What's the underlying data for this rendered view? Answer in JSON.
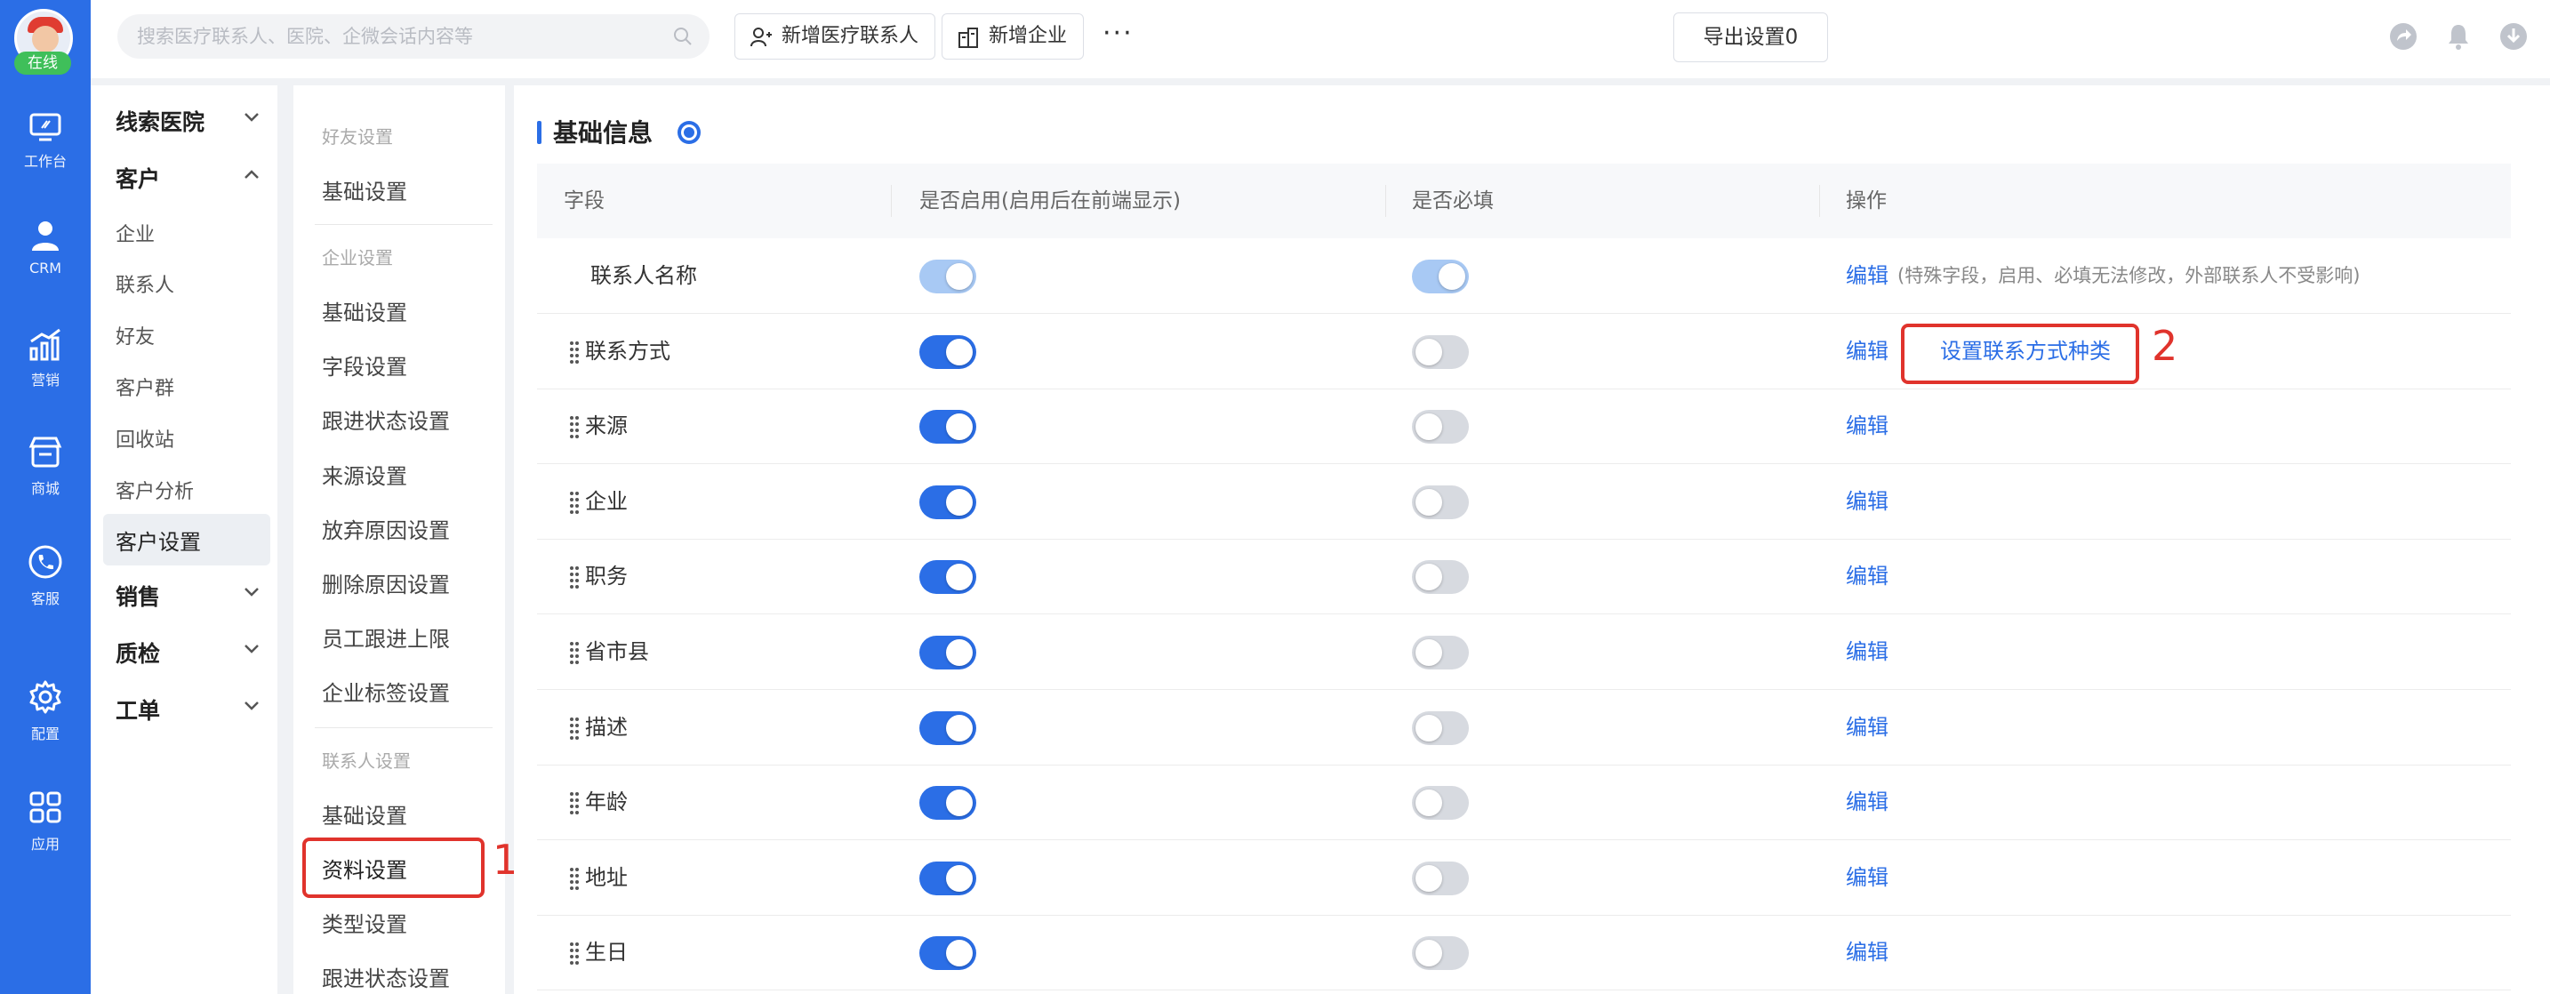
{
  "rail": {
    "online": "在线",
    "items": [
      {
        "label": "工作台",
        "icon": "monitor-icon"
      },
      {
        "label": "CRM",
        "icon": "person-icon"
      },
      {
        "label": "营销",
        "icon": "growth-chart-icon"
      },
      {
        "label": "商城",
        "icon": "store-icon"
      },
      {
        "label": "客服",
        "icon": "phone-icon"
      },
      {
        "label": "配置",
        "icon": "gear-icon"
      },
      {
        "label": "应用",
        "icon": "grid-apps-icon"
      }
    ]
  },
  "topbar": {
    "search_placeholder": "搜索医疗联系人、医院、企微会话内容等",
    "add_contact": "新增医疗联系人",
    "add_company": "新增企业",
    "more": "···",
    "export": "导出设置0"
  },
  "nav2": {
    "lead_hospital": "线索医院",
    "customer": "客户",
    "customer_items": [
      "企业",
      "联系人",
      "好友",
      "客户群",
      "回收站",
      "客户分析"
    ],
    "customer_settings": "客户设置",
    "sales": "销售",
    "quality": "质检",
    "ticket": "工单"
  },
  "nav3": {
    "friend_settings": "好友设置",
    "friend_basic": "基础设置",
    "company_settings": "企业设置",
    "company_items": [
      "基础设置",
      "字段设置",
      "跟进状态设置",
      "来源设置",
      "放弃原因设置",
      "删除原因设置",
      "员工跟进上限",
      "企业标签设置"
    ],
    "contact_settings": "联系人设置",
    "contact_basic": "基础设置",
    "profile_settings": "资料设置",
    "type_settings": "类型设置",
    "followup_status": "跟进状态设置"
  },
  "annotations": {
    "n1": "1",
    "n2": "2"
  },
  "main": {
    "section_title": "基础信息",
    "headers": {
      "field": "字段",
      "enabled": "是否启用(启用后在前端显示)",
      "required": "是否必填",
      "ops": "操作"
    },
    "edit_label": "编辑",
    "special_note": "(特殊字段，启用、必填无法修改，外部联系人不受影响)",
    "contact_type_link": "设置联系方式种类",
    "rows": [
      {
        "name": "联系人名称",
        "enabled": true,
        "required": true
      },
      {
        "name": "联系方式",
        "enabled": true,
        "required": false
      },
      {
        "name": "来源",
        "enabled": true,
        "required": false
      },
      {
        "name": "企业",
        "enabled": true,
        "required": false
      },
      {
        "name": "职务",
        "enabled": true,
        "required": false
      },
      {
        "name": "省市县",
        "enabled": true,
        "required": false
      },
      {
        "name": "描述",
        "enabled": true,
        "required": false
      },
      {
        "name": "年龄",
        "enabled": true,
        "required": false
      },
      {
        "name": "地址",
        "enabled": true,
        "required": false
      },
      {
        "name": "生日",
        "enabled": true,
        "required": false
      }
    ]
  },
  "colors": {
    "primary": "#2b6ee6",
    "annotation_red": "#e0332c",
    "online_green": "#3fbf5a"
  }
}
